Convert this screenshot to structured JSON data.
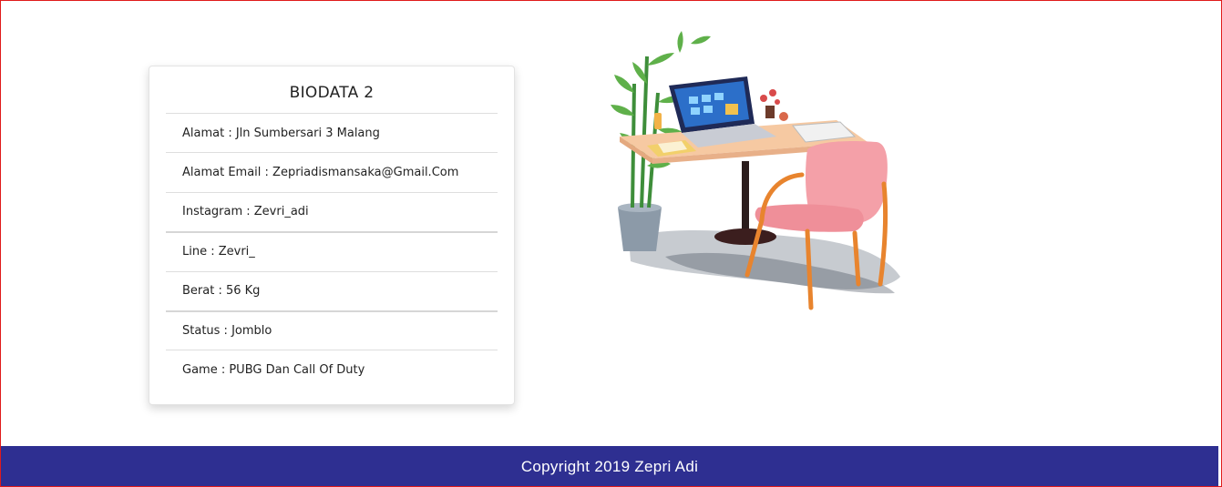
{
  "card": {
    "title": "BIODATA 2",
    "items": [
      "Alamat : Jln Sumbersari 3 Malang",
      "Alamat Email : Zepriadismansaka@Gmail.Com",
      "Instagram : Zevri_adi",
      "Line : Zevri_",
      "Berat : 56 Kg",
      "Status : Jomblo",
      "Game : PUBG Dan Call Of Duty"
    ]
  },
  "footer": {
    "text": "Copyright 2019 Zepri Adi"
  },
  "colors": {
    "footer_bg": "#2e2f91",
    "frame_border": "#e01b1b",
    "chair": "#f4a0a8",
    "desk": "#f6c9a2"
  },
  "illustration": {
    "icon": "desk-workspace-illustration"
  }
}
